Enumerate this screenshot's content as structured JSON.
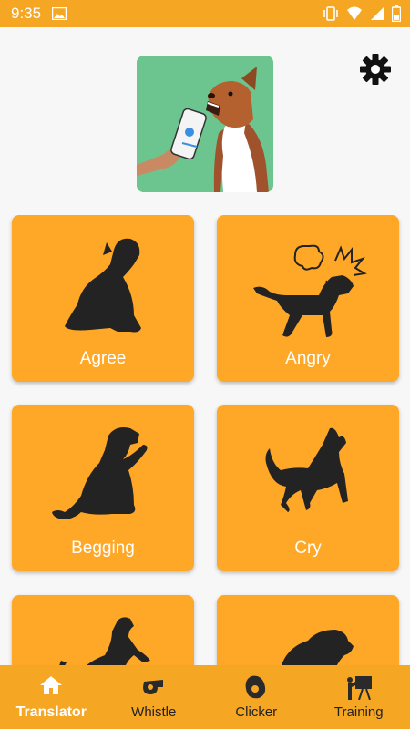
{
  "status_bar": {
    "time": "9:35",
    "icons": [
      "image-icon",
      "vibrate-icon",
      "wifi-icon",
      "cellular-icon",
      "battery-icon"
    ]
  },
  "hero": {
    "icon": "dog-translator-photo"
  },
  "settings": {
    "icon": "gear-icon"
  },
  "cards": [
    {
      "label": "Agree",
      "icon": "sitting-dog-icon"
    },
    {
      "label": "Angry",
      "icon": "angry-dog-icon"
    },
    {
      "label": "Begging",
      "icon": "begging-dog-icon"
    },
    {
      "label": "Cry",
      "icon": "howling-dog-icon"
    },
    {
      "label": "",
      "icon": "jumping-dog-icon"
    },
    {
      "label": "",
      "icon": "dog-head-icon"
    }
  ],
  "nav": {
    "items": [
      {
        "label": "Translator",
        "icon": "home-icon",
        "active": true
      },
      {
        "label": "Whistle",
        "icon": "whistle-icon",
        "active": false
      },
      {
        "label": "Clicker",
        "icon": "clicker-icon",
        "active": false
      },
      {
        "label": "Training",
        "icon": "training-icon",
        "active": false
      }
    ]
  },
  "colors": {
    "accent": "#f5a623",
    "card": "#ffa726",
    "background": "#f7f7f7",
    "silhouette": "#232323"
  }
}
